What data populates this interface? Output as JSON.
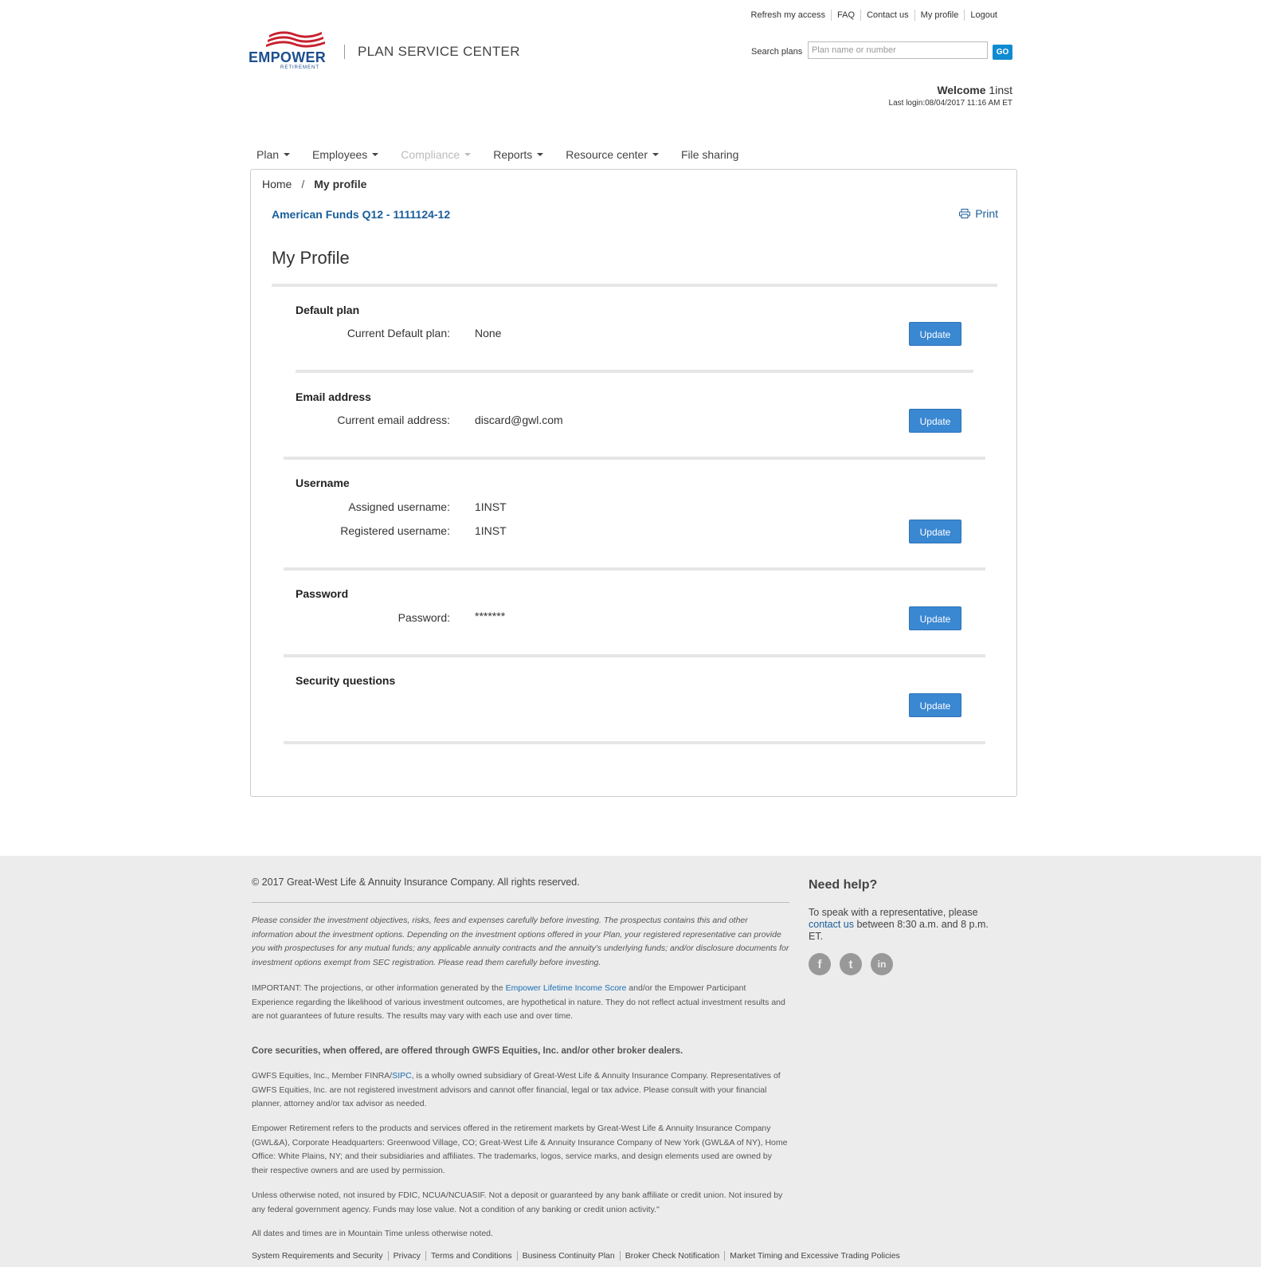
{
  "util_nav": [
    "Refresh my access",
    "FAQ",
    "Contact us",
    "My profile",
    "Logout"
  ],
  "logo": {
    "word": "EMPOWER",
    "sub": "RETIREMENT"
  },
  "site_title": "PLAN SERVICE CENTER",
  "search": {
    "label": "Search plans",
    "placeholder": "Plan name or number",
    "go": "GO"
  },
  "welcome": {
    "greeting": "Welcome",
    "user": "1inst",
    "last_login": "Last login:08/04/2017 11:16 AM ET"
  },
  "main_nav": [
    {
      "label": "Plan",
      "caret": true,
      "disabled": false
    },
    {
      "label": "Employees",
      "caret": true,
      "disabled": false
    },
    {
      "label": "Compliance",
      "caret": true,
      "disabled": true
    },
    {
      "label": "Reports",
      "caret": true,
      "disabled": false
    },
    {
      "label": "Resource center",
      "caret": true,
      "disabled": false
    },
    {
      "label": "File sharing",
      "caret": false,
      "disabled": false
    }
  ],
  "breadcrumb": {
    "home": "Home",
    "sep": "/",
    "current": "My profile"
  },
  "plan_name": "American Funds Q12 - 1111124-12",
  "print_label": "Print",
  "page_title": "My Profile",
  "sections": {
    "default_plan": {
      "title": "Default plan",
      "label": "Current Default plan:",
      "value": "None",
      "button": "Update"
    },
    "email": {
      "title": "Email address",
      "label": "Current email address:",
      "value": "discard@gwl.com",
      "button": "Update"
    },
    "username": {
      "title": "Username",
      "assigned_label": "Assigned username:",
      "assigned_value": "1INST",
      "registered_label": "Registered username:",
      "registered_value": "1INST",
      "button": "Update"
    },
    "password": {
      "title": "Password",
      "label": "Password:",
      "value": "*******",
      "button": "Update"
    },
    "security": {
      "title": "Security questions",
      "button": "Update"
    }
  },
  "footer": {
    "copyright": "© 2017 Great-West Life & Annuity Insurance Company. All rights reserved.",
    "disclaimer1": "Please consider the investment objectives, risks, fees and expenses carefully before investing. The prospectus contains this and other information about the investment options. Depending on the investment options offered in your Plan, your registered representative can provide you with prospectuses for any mutual funds; any applicable annuity contracts and the annuity's underlying funds; and/or disclosure documents for investment options exempt from SEC registration. Please read them carefully before investing.",
    "important_pre": "IMPORTANT: The projections, or other information generated by the ",
    "important_link": "Empower Lifetime Income Score",
    "important_post": " and/or the Empower Participant Experience regarding the likelihood of various investment outcomes, are hypothetical in nature. They do not reflect actual investment results and are not guarantees of future results. The results may vary with each use and over time.",
    "core": "Core securities, when offered, are offered through GWFS Equities, Inc. and/or other broker dealers.",
    "gwfs_pre": "GWFS Equities, Inc., Member FINRA/",
    "gwfs_link": "SIPC",
    "gwfs_post": ", is a wholly owned subsidiary of Great-West Life & Annuity Insurance Company. Representatives of GWFS Equities, Inc. are not registered investment advisors and cannot offer financial, legal or tax advice. Please consult with your financial planner, attorney and/or tax advisor as needed.",
    "empower": "Empower Retirement refers to the products and services offered in the retirement markets by Great-West Life & Annuity Insurance Company (GWL&A), Corporate Headquarters: Greenwood Village, CO; Great-West Life & Annuity Insurance Company of New York (GWL&A of NY), Home Office: White Plains, NY; and their subsidiaries and affiliates. The trademarks, logos, service marks, and design elements used are owned by their respective owners and are used by permission.",
    "fdic": "Unless otherwise noted, not insured by FDIC, NCUA/NCUASIF. Not a deposit or guaranteed by any bank affiliate or credit union. Not insured by any federal government agency. Funds may lose value. Not a condition of any banking or credit union activity.\"",
    "dates": "All dates and times are in Mountain Time unless otherwise noted.",
    "links": [
      "System Requirements and Security",
      "Privacy",
      "Terms and Conditions",
      "Business Continuity Plan",
      "Broker Check Notification",
      "Market Timing and Excessive Trading Policies"
    ],
    "help_title": "Need help?",
    "help_pre": "To speak with a representative, please",
    "help_link": "contact us",
    "help_post": " between 8:30 a.m. and 8 p.m. ET.",
    "social": [
      {
        "name": "facebook-icon",
        "glyph": "f"
      },
      {
        "name": "twitter-icon",
        "glyph": "t"
      },
      {
        "name": "linkedin-icon",
        "glyph": "in"
      }
    ]
  }
}
